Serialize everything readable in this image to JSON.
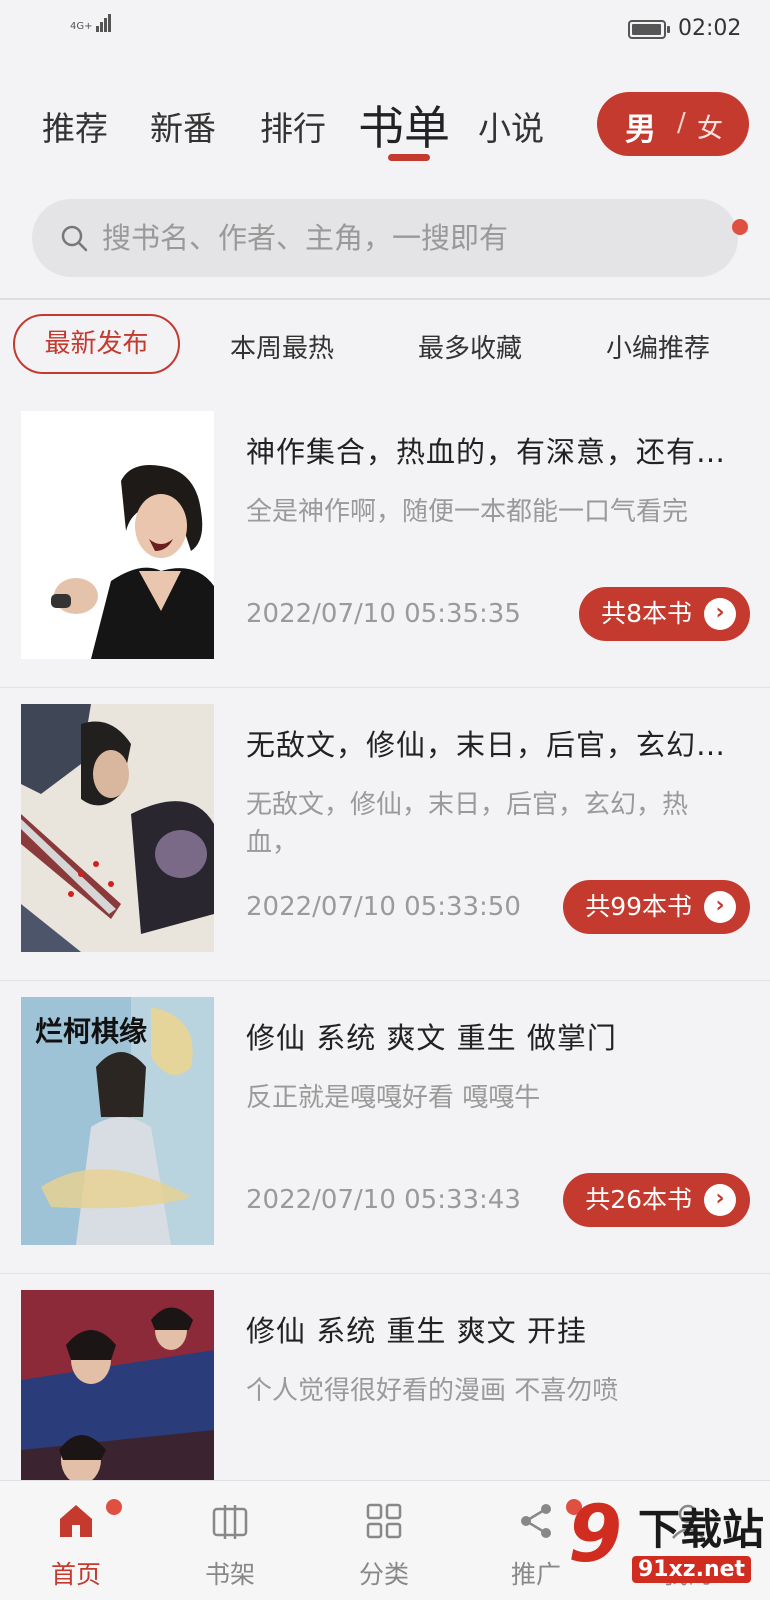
{
  "status_bar": {
    "network": "4G+",
    "time": "02:02"
  },
  "top_tabs": [
    {
      "label": "推荐",
      "active": false
    },
    {
      "label": "新番",
      "active": false
    },
    {
      "label": "排行",
      "active": false
    },
    {
      "label": "书单",
      "active": true
    },
    {
      "label": "小说",
      "active": false
    }
  ],
  "gender_toggle": {
    "male": "男",
    "separator": "/",
    "female": "女",
    "selected": "男"
  },
  "search": {
    "placeholder": "搜书名、作者、主角，一搜即有"
  },
  "filter_tabs": [
    {
      "label": "最新发布",
      "active": true
    },
    {
      "label": "本周最热",
      "active": false
    },
    {
      "label": "最多收藏",
      "active": false
    },
    {
      "label": "小编推荐",
      "active": false
    }
  ],
  "booklists": [
    {
      "title": "神作集合，热血的，有深意，还有…",
      "desc": "全是神作啊，随便一本都能一口气看完",
      "date": "2022/07/10 05:35:35",
      "count": "共8本书"
    },
    {
      "title": "无敌文，修仙，末日，后官，玄幻…",
      "desc": "无敌文，修仙，末日，后官，玄幻，热血，",
      "date": "2022/07/10 05:33:50",
      "count": "共99本书"
    },
    {
      "title": "修仙 系统 爽文 重生 做掌门",
      "desc": "反正就是嘎嘎好看 嘎嘎牛",
      "date": "2022/07/10 05:33:43",
      "count": "共26本书"
    },
    {
      "title": "修仙 系统  重生 爽文  开挂",
      "desc": "个人觉得很好看的漫画 不喜勿喷",
      "date": "",
      "count": ""
    }
  ],
  "cover_art": {
    "third_cover_title": "烂柯棋缘"
  },
  "bottom_nav": [
    {
      "label": "首页",
      "icon": "home-icon",
      "active": true
    },
    {
      "label": "书架",
      "icon": "bookshelf-icon",
      "active": false
    },
    {
      "label": "分类",
      "icon": "category-icon",
      "active": false
    },
    {
      "label": "推广",
      "icon": "share-icon",
      "active": false
    },
    {
      "label": "我的",
      "icon": "user-icon",
      "active": false
    }
  ],
  "watermark": {
    "logo_mark": "9",
    "title": "下载站",
    "url": "91xz.net"
  },
  "colors": {
    "accent": "#c43a2f",
    "background": "#f3f3f5",
    "muted_text": "#9a9a9a"
  }
}
